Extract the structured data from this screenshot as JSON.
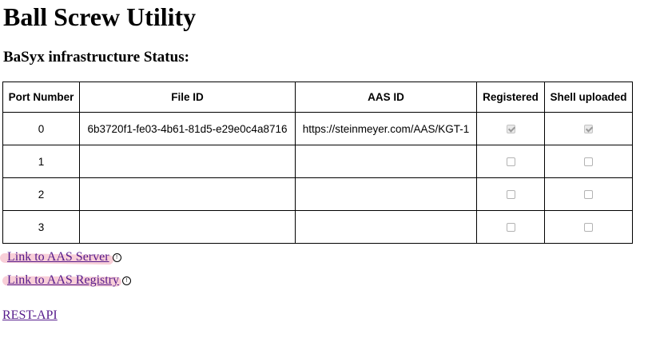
{
  "page": {
    "title": "Ball Screw Utility",
    "section_title": "BaSyx infrastructure Status:"
  },
  "table": {
    "headers": [
      "Port Number",
      "File ID",
      "AAS ID",
      "Registered",
      "Shell uploaded"
    ],
    "rows": [
      {
        "port": "0",
        "file_id": "6b3720f1-fe03-4b61-81d5-e29e0c4a8716",
        "aas_id": "https://steinmeyer.com/AAS/KGT-1",
        "registered": true,
        "shell_uploaded": true
      },
      {
        "port": "1",
        "file_id": "",
        "aas_id": "",
        "registered": false,
        "shell_uploaded": false
      },
      {
        "port": "2",
        "file_id": "",
        "aas_id": "",
        "registered": false,
        "shell_uploaded": false
      },
      {
        "port": "3",
        "file_id": "",
        "aas_id": "",
        "registered": false,
        "shell_uploaded": false
      }
    ]
  },
  "links": {
    "aas_server": "Link to AAS Server",
    "aas_registry": "Link to AAS Registry",
    "rest_api": "REST-API"
  },
  "icons": {
    "info": "info-icon"
  },
  "colors": {
    "link_visited": "#551a8b",
    "highlight": "#f2a7b8"
  }
}
